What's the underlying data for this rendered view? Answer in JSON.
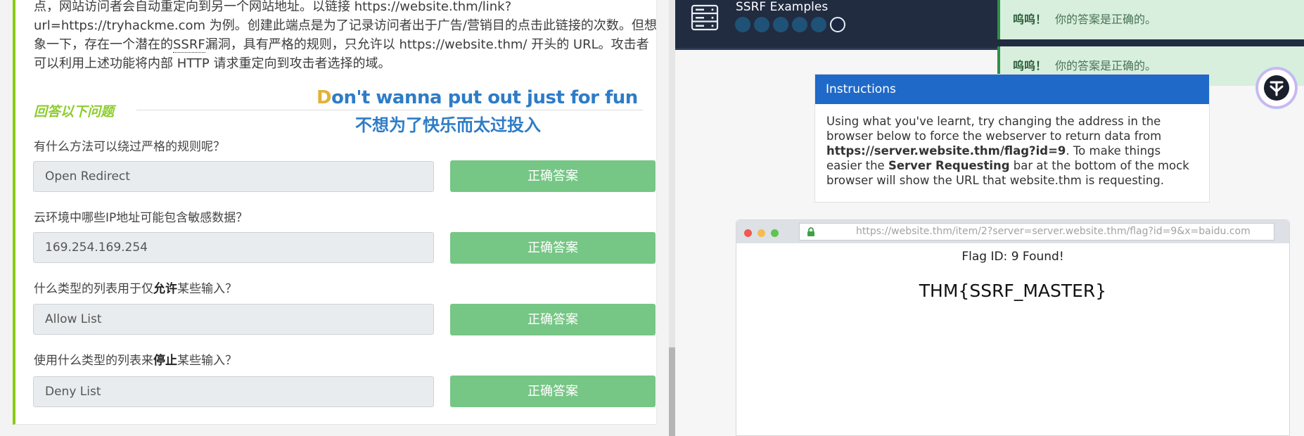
{
  "task": {
    "intro_lines": [
      "点，网站访问者会自动重定向到另一个网站地址。以链接 https://website.thm/link?",
      "url=https://tryhackme.com 为例。创建此端点是为了记录访问者出于广告/营销目的点击此链接的次数。但想",
      "象一下，存在一个潜在的",
      "SSRF",
      "漏洞，具有严格的规则，只允许以 https://website.thm/ 开头的 URL。攻击者",
      "可以利用上述功能将内部 HTTP 请求重定向到攻击者选择的域。"
    ],
    "section_title": "回答以下问题",
    "questions": [
      {
        "label": "有什么方法可以绕过严格的规则呢？",
        "answer": "Open Redirect",
        "button": "正确答案"
      },
      {
        "label_pre": "云环境中哪些",
        "label_bold": "IP",
        "label_post": "地址可能包含敏感数据？",
        "answer": "169.254.169.254",
        "button": "正确答案"
      },
      {
        "label_pre": "什么类型的列表用于仅",
        "label_bold": "允许",
        "label_post": "某些输入？",
        "answer": "Allow List",
        "button": "正确答案"
      },
      {
        "label_pre": "使用什么类型的列表来",
        "label_bold": "停止",
        "label_post": "某些输入？",
        "answer": "Deny List",
        "button": "正确答案"
      }
    ]
  },
  "subtitles": {
    "en_first": "D",
    "en_rest": "on't wanna put out just for fun",
    "zh": "不想为了快乐而太过投入"
  },
  "app": {
    "title": "SSRF Examples",
    "progress_total": 6,
    "progress_current": 6,
    "toasts": [
      {
        "strong": "呜呜！",
        "text": "你的答案是正确的。"
      },
      {
        "strong": "呜呜！",
        "text": "你的答案是正确的。"
      }
    ],
    "instructions": {
      "heading": "Instructions",
      "text_1": "Using what you've learnt, try changing the address in the browser below to force the webserver to return data from ",
      "url_bold": "https://server.website.thm/flag?id=9",
      "text_2": ". To make things easier the ",
      "bar_bold": "Server Requesting",
      "text_3": " bar at the bottom of the mock browser will show the URL that website.thm is requesting."
    },
    "browser": {
      "address": "https://website.thm/item/2?server=server.website.thm/flag?id=9&x=baidu.com",
      "flag_found": "Flag ID: 9 Found!",
      "flag_value": "THM{SSRF_MASTER}"
    },
    "colors": {
      "topbar": "#212c41",
      "progress_dot": "#1f5277",
      "toast_bg": "#d8efdd",
      "instructions_header": "#1f69c9",
      "correct_button": "#76c685",
      "accent_green": "#88cc14"
    }
  }
}
